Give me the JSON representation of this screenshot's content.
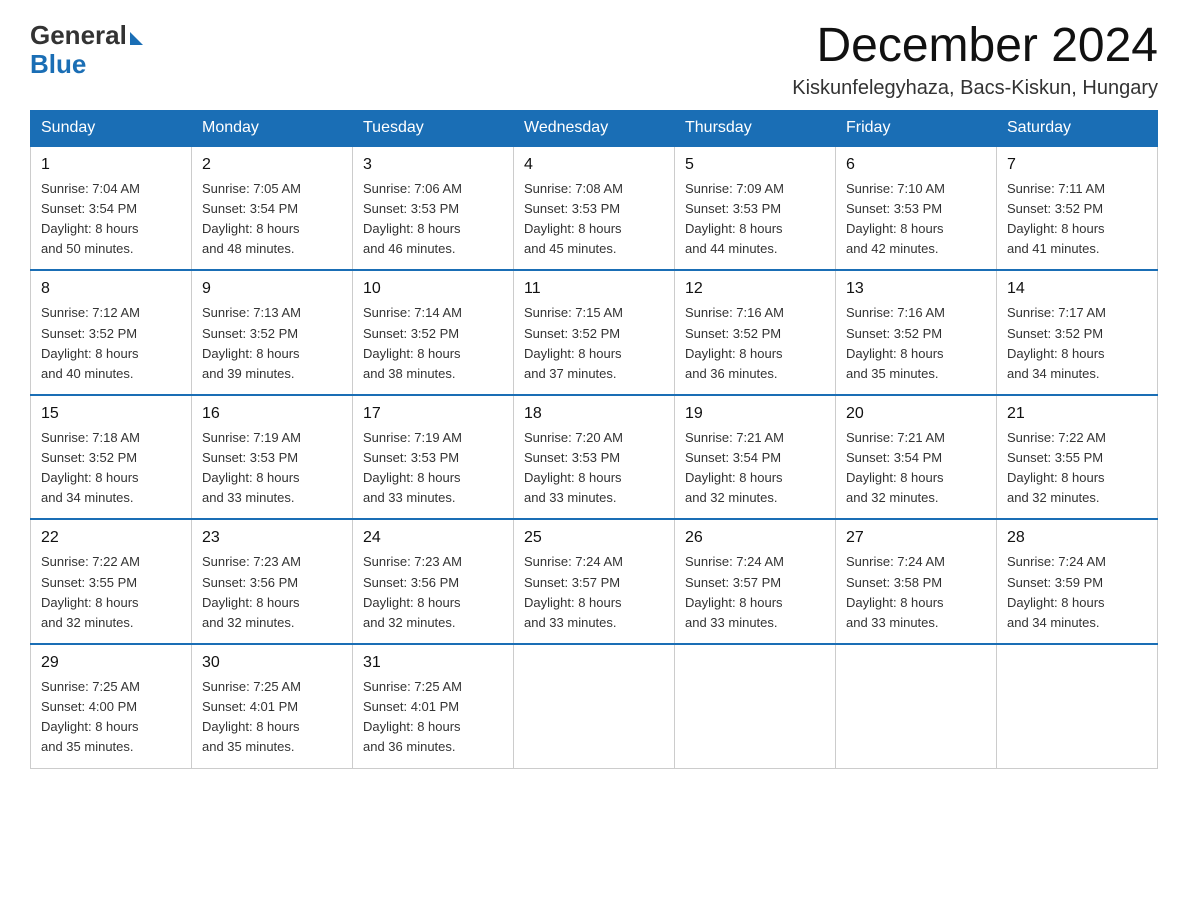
{
  "header": {
    "title": "December 2024",
    "subtitle": "Kiskunfelegyhaza, Bacs-Kiskun, Hungary",
    "logo_general": "General",
    "logo_blue": "Blue"
  },
  "calendar": {
    "days_of_week": [
      "Sunday",
      "Monday",
      "Tuesday",
      "Wednesday",
      "Thursday",
      "Friday",
      "Saturday"
    ],
    "weeks": [
      [
        {
          "day": "1",
          "sunrise": "7:04 AM",
          "sunset": "3:54 PM",
          "daylight": "8 hours and 50 minutes."
        },
        {
          "day": "2",
          "sunrise": "7:05 AM",
          "sunset": "3:54 PM",
          "daylight": "8 hours and 48 minutes."
        },
        {
          "day": "3",
          "sunrise": "7:06 AM",
          "sunset": "3:53 PM",
          "daylight": "8 hours and 46 minutes."
        },
        {
          "day": "4",
          "sunrise": "7:08 AM",
          "sunset": "3:53 PM",
          "daylight": "8 hours and 45 minutes."
        },
        {
          "day": "5",
          "sunrise": "7:09 AM",
          "sunset": "3:53 PM",
          "daylight": "8 hours and 44 minutes."
        },
        {
          "day": "6",
          "sunrise": "7:10 AM",
          "sunset": "3:53 PM",
          "daylight": "8 hours and 42 minutes."
        },
        {
          "day": "7",
          "sunrise": "7:11 AM",
          "sunset": "3:52 PM",
          "daylight": "8 hours and 41 minutes."
        }
      ],
      [
        {
          "day": "8",
          "sunrise": "7:12 AM",
          "sunset": "3:52 PM",
          "daylight": "8 hours and 40 minutes."
        },
        {
          "day": "9",
          "sunrise": "7:13 AM",
          "sunset": "3:52 PM",
          "daylight": "8 hours and 39 minutes."
        },
        {
          "day": "10",
          "sunrise": "7:14 AM",
          "sunset": "3:52 PM",
          "daylight": "8 hours and 38 minutes."
        },
        {
          "day": "11",
          "sunrise": "7:15 AM",
          "sunset": "3:52 PM",
          "daylight": "8 hours and 37 minutes."
        },
        {
          "day": "12",
          "sunrise": "7:16 AM",
          "sunset": "3:52 PM",
          "daylight": "8 hours and 36 minutes."
        },
        {
          "day": "13",
          "sunrise": "7:16 AM",
          "sunset": "3:52 PM",
          "daylight": "8 hours and 35 minutes."
        },
        {
          "day": "14",
          "sunrise": "7:17 AM",
          "sunset": "3:52 PM",
          "daylight": "8 hours and 34 minutes."
        }
      ],
      [
        {
          "day": "15",
          "sunrise": "7:18 AM",
          "sunset": "3:52 PM",
          "daylight": "8 hours and 34 minutes."
        },
        {
          "day": "16",
          "sunrise": "7:19 AM",
          "sunset": "3:53 PM",
          "daylight": "8 hours and 33 minutes."
        },
        {
          "day": "17",
          "sunrise": "7:19 AM",
          "sunset": "3:53 PM",
          "daylight": "8 hours and 33 minutes."
        },
        {
          "day": "18",
          "sunrise": "7:20 AM",
          "sunset": "3:53 PM",
          "daylight": "8 hours and 33 minutes."
        },
        {
          "day": "19",
          "sunrise": "7:21 AM",
          "sunset": "3:54 PM",
          "daylight": "8 hours and 32 minutes."
        },
        {
          "day": "20",
          "sunrise": "7:21 AM",
          "sunset": "3:54 PM",
          "daylight": "8 hours and 32 minutes."
        },
        {
          "day": "21",
          "sunrise": "7:22 AM",
          "sunset": "3:55 PM",
          "daylight": "8 hours and 32 minutes."
        }
      ],
      [
        {
          "day": "22",
          "sunrise": "7:22 AM",
          "sunset": "3:55 PM",
          "daylight": "8 hours and 32 minutes."
        },
        {
          "day": "23",
          "sunrise": "7:23 AM",
          "sunset": "3:56 PM",
          "daylight": "8 hours and 32 minutes."
        },
        {
          "day": "24",
          "sunrise": "7:23 AM",
          "sunset": "3:56 PM",
          "daylight": "8 hours and 32 minutes."
        },
        {
          "day": "25",
          "sunrise": "7:24 AM",
          "sunset": "3:57 PM",
          "daylight": "8 hours and 33 minutes."
        },
        {
          "day": "26",
          "sunrise": "7:24 AM",
          "sunset": "3:57 PM",
          "daylight": "8 hours and 33 minutes."
        },
        {
          "day": "27",
          "sunrise": "7:24 AM",
          "sunset": "3:58 PM",
          "daylight": "8 hours and 33 minutes."
        },
        {
          "day": "28",
          "sunrise": "7:24 AM",
          "sunset": "3:59 PM",
          "daylight": "8 hours and 34 minutes."
        }
      ],
      [
        {
          "day": "29",
          "sunrise": "7:25 AM",
          "sunset": "4:00 PM",
          "daylight": "8 hours and 35 minutes."
        },
        {
          "day": "30",
          "sunrise": "7:25 AM",
          "sunset": "4:01 PM",
          "daylight": "8 hours and 35 minutes."
        },
        {
          "day": "31",
          "sunrise": "7:25 AM",
          "sunset": "4:01 PM",
          "daylight": "8 hours and 36 minutes."
        },
        null,
        null,
        null,
        null
      ]
    ],
    "labels": {
      "sunrise": "Sunrise:",
      "sunset": "Sunset:",
      "daylight": "Daylight:"
    }
  }
}
